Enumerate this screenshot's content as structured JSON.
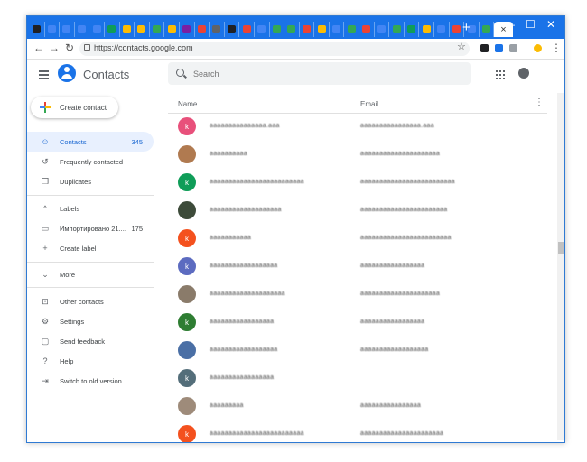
{
  "browser": {
    "tab_colors": [
      "#202124",
      "#4285f4",
      "#4285f4",
      "#4285f4",
      "#4285f4",
      "#0f9d58",
      "#fbbc04",
      "#fbbc04",
      "#34a853",
      "#fbbc04",
      "#7b1fa2",
      "#ea4335",
      "#5f6368",
      "#202124",
      "#ea4335",
      "#4285f4",
      "#34a853",
      "#34a853",
      "#ea4335",
      "#fbbc04",
      "#4285f4",
      "#34a853",
      "#ea4335",
      "#4285f4",
      "#34a853",
      "#0f9d58",
      "#fbbc04",
      "#4285f4",
      "#ea4335",
      "#4285f4",
      "#34a853"
    ],
    "active_tab_close": "×",
    "new_tab": "+",
    "url": "https://contacts.google.com",
    "ext_colors": [
      "#fbbc04",
      "#1a73e8",
      "#5f6368",
      "#fbbc04"
    ]
  },
  "header": {
    "app_title": "Contacts",
    "search_placeholder": "Search"
  },
  "sidebar": {
    "create_label": "Create contact",
    "items": [
      {
        "label": "Contacts",
        "count": "345",
        "icon": "person"
      },
      {
        "label": "Frequently contacted",
        "count": "",
        "icon": "history"
      },
      {
        "label": "Duplicates",
        "count": "",
        "icon": "copy"
      },
      {
        "label": "Labels",
        "count": "",
        "icon": "chevron-up"
      },
      {
        "label": "Импортировано 21....",
        "count": "175",
        "icon": "label"
      },
      {
        "label": "Create label",
        "count": "",
        "icon": "plus"
      },
      {
        "label": "More",
        "count": "",
        "icon": "chevron-down"
      },
      {
        "label": "Other contacts",
        "count": "",
        "icon": "other"
      },
      {
        "label": "Settings",
        "count": "",
        "icon": "gear"
      },
      {
        "label": "Send feedback",
        "count": "",
        "icon": "feedback"
      },
      {
        "label": "Help",
        "count": "",
        "icon": "help"
      },
      {
        "label": "Switch to old version",
        "count": "",
        "icon": "exit"
      }
    ]
  },
  "table": {
    "col_name": "Name",
    "col_email": "Email",
    "more": "⋮",
    "rows": [
      {
        "initial": "k",
        "color": "#e8507b",
        "name": "aaaaaaaaaaaaaaa.aaa",
        "email": "aaaaaaaaaaaaaaaa.aaa"
      },
      {
        "initial": "",
        "color": "#b07a50",
        "name": "aaaaaaaaaa",
        "email": "aaaaaaaaaaaaaaaaaaaaa"
      },
      {
        "initial": "k",
        "color": "#0f9d58",
        "name": "aaaaaaaaaaaaaaaaaaaaaaaaa",
        "email": "aaaaaaaaaaaaaaaaaaaaaaaaa"
      },
      {
        "initial": "",
        "color": "#3d4b3a",
        "name": "aaaaaaaaaaaaaaaaaaa",
        "email": "aaaaaaaaaaaaaaaaaaaaaaa"
      },
      {
        "initial": "k",
        "color": "#f4511e",
        "name": "aaaaaaaaaaa",
        "email": "aaaaaaaaaaaaaaaaaaaaaaaa"
      },
      {
        "initial": "k",
        "color": "#5c6bc0",
        "name": "aaaaaaaaaaaaaaaaaa",
        "email": "aaaaaaaaaaaaaaaaa"
      },
      {
        "initial": "",
        "color": "#8a7b6a",
        "name": "aaaaaaaaaaaaaaaaaaaa",
        "email": "aaaaaaaaaaaaaaaaaaaaa"
      },
      {
        "initial": "k",
        "color": "#2e7d32",
        "name": "aaaaaaaaaaaaaaaaa",
        "email": "aaaaaaaaaaaaaaaaa"
      },
      {
        "initial": "",
        "color": "#4a6fa5",
        "name": "aaaaaaaaaaaaaaaaaa",
        "email": "aaaaaaaaaaaaaaaaaa"
      },
      {
        "initial": "k",
        "color": "#546e7a",
        "name": "aaaaaaaaaaaaaaaaa",
        "email": ""
      },
      {
        "initial": "",
        "color": "#9e8b7a",
        "name": "aaaaaaaaa",
        "email": "aaaaaaaaaaaaaaaa"
      },
      {
        "initial": "k",
        "color": "#f4511e",
        "name": "aaaaaaaaaaaaaaaaaaaaaaaaa",
        "email": "aaaaaaaaaaaaaaaaaaaaaa"
      }
    ]
  }
}
